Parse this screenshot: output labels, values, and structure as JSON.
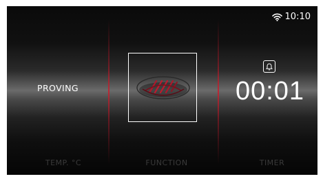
{
  "status_bar": {
    "time": "10:10",
    "wifi_icon": "wifi-icon"
  },
  "columns": {
    "temperature_label": "TEMP. °C",
    "function_label": "FUNCTION",
    "timer_label": "TIMER"
  },
  "mode": {
    "label": "PROVING"
  },
  "function": {
    "icon": "bread-proving-icon"
  },
  "timer": {
    "alarm_icon": "bell-icon",
    "value": "00:01"
  },
  "colors": {
    "accent_red": "#c0182a",
    "text": "#ffffff",
    "inactive_label": "#3a3a3a"
  }
}
